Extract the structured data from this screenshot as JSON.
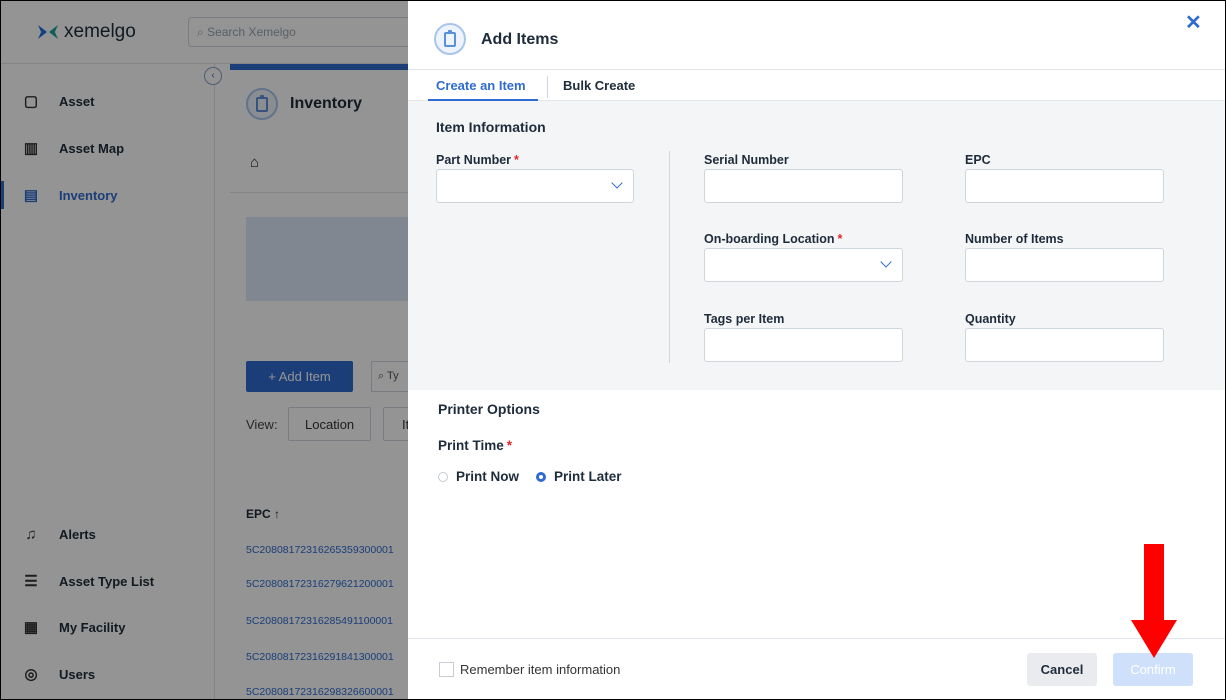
{
  "app": {
    "logo": "xemelgo",
    "search_placeholder": "Search Xemelgo"
  },
  "sidebar": {
    "items": [
      {
        "label": "Asset",
        "icon": "asset-icon"
      },
      {
        "label": "Asset Map",
        "icon": "map-icon"
      },
      {
        "label": "Inventory",
        "icon": "clipboard-icon",
        "active": true
      },
      {
        "label": "Alerts",
        "icon": "bell-icon"
      },
      {
        "label": "Asset Type List",
        "icon": "list-icon"
      },
      {
        "label": "My Facility",
        "icon": "facility-icon"
      },
      {
        "label": "Users",
        "icon": "user-icon"
      }
    ]
  },
  "main": {
    "title": "Inventory",
    "add_item_label": "+ Add Item",
    "filter_placeholder": "Ty",
    "view_label": "View:",
    "view_options": [
      "Location",
      "It"
    ],
    "table_header": "EPC ↑",
    "epc_rows": [
      "5C20808172316265359300001",
      "5C20808172316279621200001",
      "5C20808172316285491100001",
      "5C20808172316291841300001",
      "5C20808172316298326600001"
    ]
  },
  "drawer": {
    "title": "Add Items",
    "close": "✕",
    "tabs": [
      {
        "label": "Create an Item",
        "active": true
      },
      {
        "label": "Bulk Create",
        "active": false
      }
    ],
    "item_information": {
      "title": "Item Information",
      "part_number": "Part Number",
      "serial_number": "Serial Number",
      "epc": "EPC",
      "onboarding_location": "On-boarding Location",
      "number_of_items": "Number of Items",
      "tags_per_item": "Tags per Item",
      "quantity": "Quantity"
    },
    "printer_options": {
      "title": "Printer Options",
      "print_time": "Print Time",
      "print_now": "Print Now",
      "print_later": "Print Later",
      "selected": "Print Later"
    },
    "footer": {
      "remember": "Remember item information",
      "cancel": "Cancel",
      "confirm": "Confirm"
    }
  },
  "annotation": {
    "arrow_color": "#ff0000"
  }
}
